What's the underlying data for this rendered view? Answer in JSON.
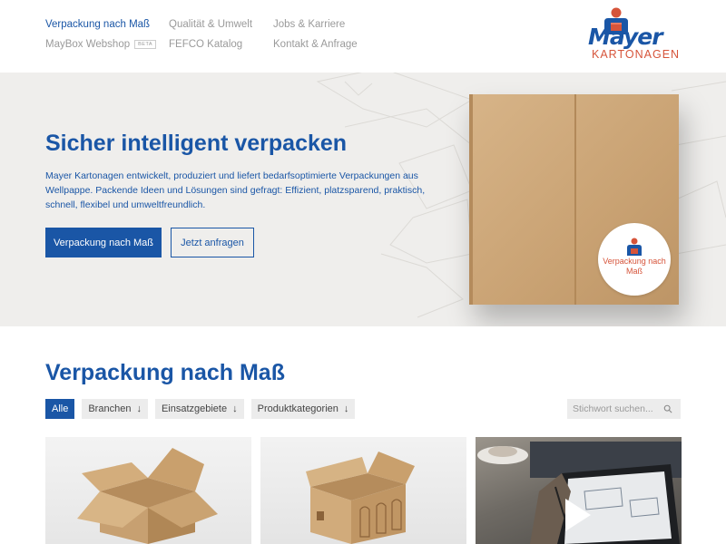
{
  "nav": {
    "items": [
      {
        "label": "Verpackung nach Maß",
        "active": true
      },
      {
        "label": "Qualität & Umwelt",
        "active": false
      },
      {
        "label": "Jobs & Karriere",
        "active": false
      },
      {
        "label": "MayBox Webshop",
        "active": false,
        "badge": "BETA"
      },
      {
        "label": "FEFCO Katalog",
        "active": false
      },
      {
        "label": "Kontakt & Anfrage",
        "active": false
      }
    ]
  },
  "logo": {
    "word": "Mayer",
    "sub": "KARTONAGEN"
  },
  "hero": {
    "title": "Sicher intelligent verpacken",
    "text": "Mayer Kartonagen entwickelt, produziert und liefert bedarfsoptimierte Verpackungen aus Wellpappe. Packende Ideen und Lösungen sind gefragt: Effizient, platzsparend, praktisch, schnell, flexibel und umweltfreundlich.",
    "primary_button": "Verpackung nach Maß",
    "secondary_button": "Jetzt anfragen",
    "sticker_text": "Verpackung nach Maß"
  },
  "section": {
    "title": "Verpackung nach Maß",
    "filters": [
      {
        "label": "Alle",
        "active": true,
        "dropdown": false
      },
      {
        "label": "Branchen",
        "active": false,
        "dropdown": true
      },
      {
        "label": "Einsatzgebiete",
        "active": false,
        "dropdown": true
      },
      {
        "label": "Produktkategorien",
        "active": false,
        "dropdown": true
      }
    ],
    "search_placeholder": "Stichwort suchen..."
  },
  "colors": {
    "brand_blue": "#1a56a6",
    "brand_red": "#d6543a",
    "hero_bg": "#efeeec",
    "cardboard": "#c9a273"
  }
}
